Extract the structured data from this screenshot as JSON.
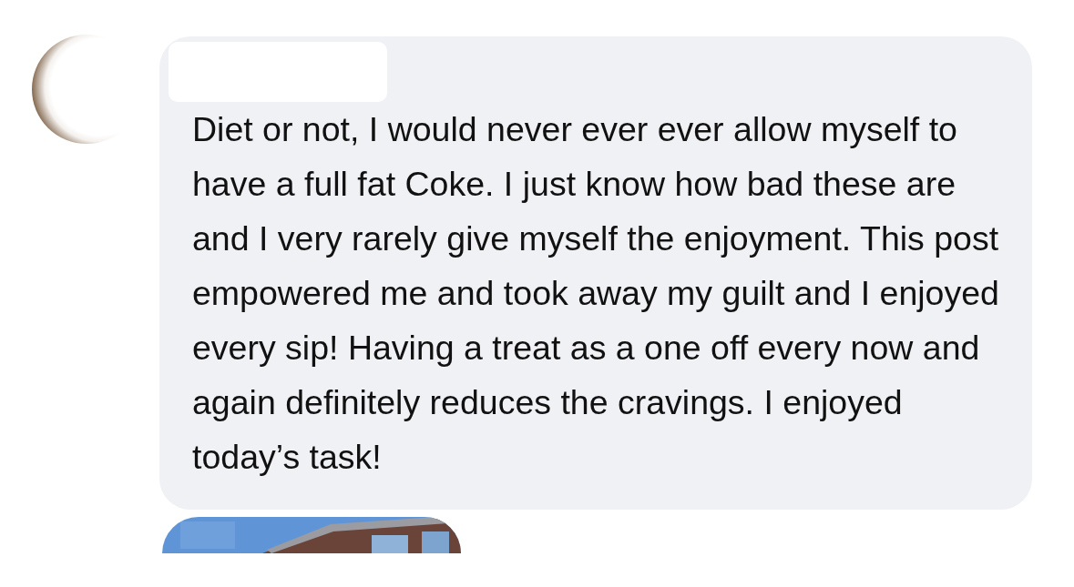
{
  "comment": {
    "author_name_redacted": true,
    "text": "Diet or not, I would never ever ever allow myself to have a full fat Coke. I just know how bad these are and I very rarely give myself the enjoyment. This post empowered me and took away my guilt and I enjoyed every sip! Having a treat as a one off every now and again definitely reduces the cravings. I enjoyed today’s task!"
  }
}
